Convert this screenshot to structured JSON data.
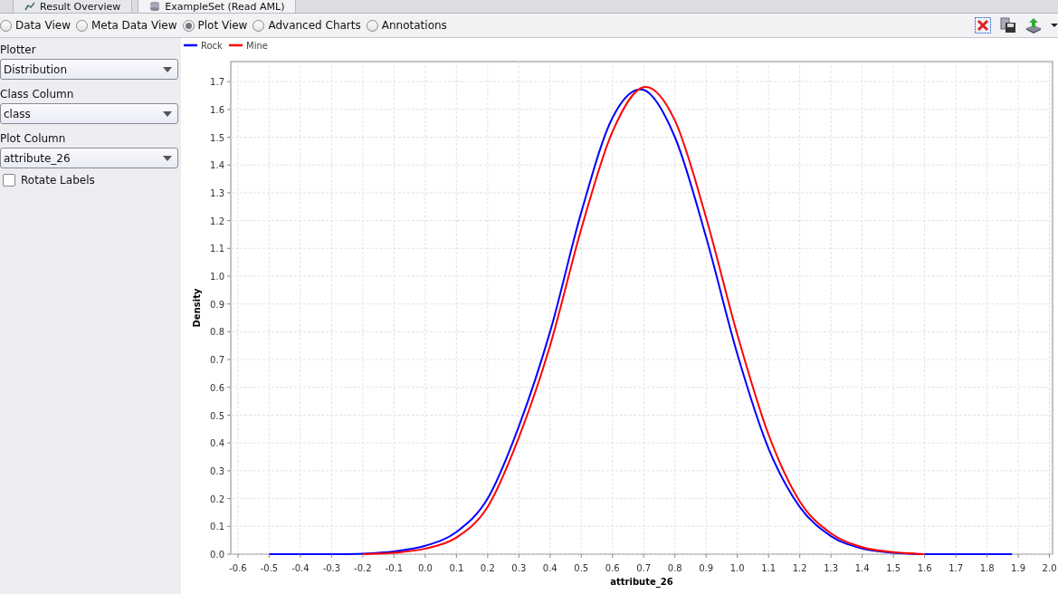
{
  "tabs": [
    {
      "label": "Result Overview",
      "selected": false
    },
    {
      "label": "ExampleSet (Read AML)",
      "selected": true
    }
  ],
  "view_options": [
    {
      "label": "Data View",
      "selected": false
    },
    {
      "label": "Meta Data View",
      "selected": false
    },
    {
      "label": "Plot View",
      "selected": true
    },
    {
      "label": "Advanced Charts",
      "selected": false
    },
    {
      "label": "Annotations",
      "selected": false
    }
  ],
  "sidebar": {
    "fields": [
      {
        "label": "Plotter",
        "value": "Distribution"
      },
      {
        "label": "Class Column",
        "value": "class"
      },
      {
        "label": "Plot Column",
        "value": "attribute_26"
      }
    ],
    "checkbox": {
      "label": "Rotate Labels",
      "checked": false
    }
  },
  "plot": {
    "chart_data": {
      "type": "line",
      "xlabel": "attribute_26",
      "ylabel": "Density",
      "x": [
        -0.5,
        -0.4,
        -0.3,
        -0.2,
        -0.1,
        0.0,
        0.1,
        0.2,
        0.3,
        0.4,
        0.5,
        0.6,
        0.7,
        0.8,
        0.9,
        1.0,
        1.1,
        1.2,
        1.3,
        1.4,
        1.5,
        1.6,
        1.7,
        1.8,
        1.88
      ],
      "series": [
        {
          "name": "Rock",
          "color": "#0000ff",
          "values": [
            0,
            0,
            0,
            0.002,
            0.01,
            0.03,
            0.08,
            0.2,
            0.46,
            0.8,
            1.23,
            1.57,
            1.67,
            1.5,
            1.14,
            0.72,
            0.38,
            0.17,
            0.065,
            0.02,
            0.005,
            0,
            0,
            0,
            0
          ]
        },
        {
          "name": "Mine",
          "color": "#ff0000",
          "values": [
            null,
            null,
            null,
            0,
            0.005,
            0.02,
            0.06,
            0.17,
            0.42,
            0.75,
            1.17,
            1.52,
            1.68,
            1.56,
            1.21,
            0.79,
            0.43,
            0.19,
            0.075,
            0.025,
            0.007,
            0,
            null,
            null,
            null
          ]
        }
      ],
      "xlim": [
        -0.623,
        2.01
      ],
      "ylim": [
        0,
        1.772
      ],
      "xticks": [
        -0.6,
        -0.5,
        -0.4,
        -0.3,
        -0.2,
        -0.1,
        {
          "value": 0,
          "label": "0.0"
        },
        0.1,
        0.2,
        0.3,
        0.4,
        0.5,
        0.6,
        0.7,
        0.8,
        0.9,
        {
          "value": 1,
          "label": "1.0"
        },
        1.1,
        1.2,
        1.3,
        1.4,
        1.5,
        1.6,
        1.7,
        1.8,
        1.9,
        {
          "value": 2,
          "label": "2.0"
        }
      ],
      "yticks": [
        {
          "value": 0,
          "label": "0.0"
        },
        0.1,
        0.2,
        0.3,
        0.4,
        0.5,
        0.6,
        0.7,
        0.8,
        0.9,
        {
          "value": 1,
          "label": "1.0"
        },
        1.1,
        1.2,
        1.3,
        1.4,
        1.5,
        1.6,
        1.7
      ],
      "grid": true,
      "legend": "top-left"
    }
  }
}
